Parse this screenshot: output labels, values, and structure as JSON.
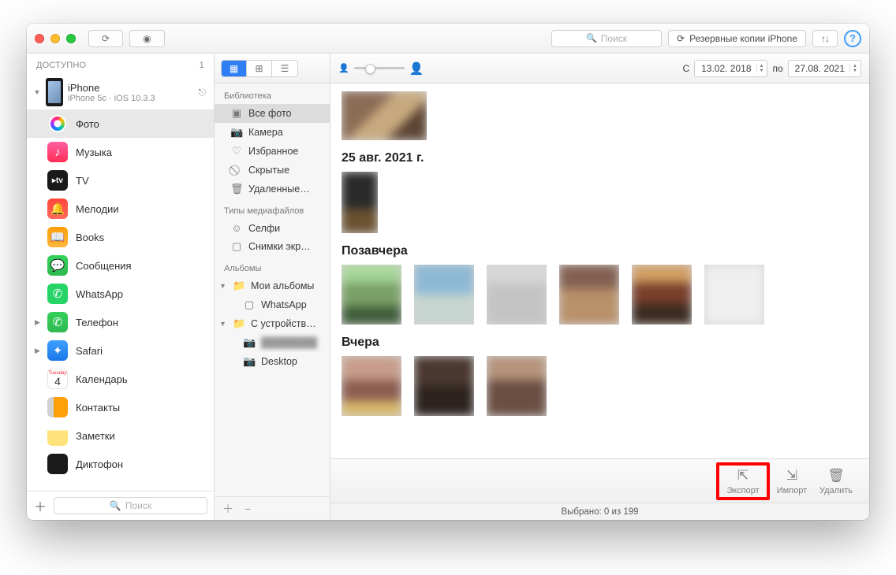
{
  "toolbar": {
    "search_placeholder": "Поиск",
    "backup_label": "Резервные копии iPhone",
    "help_label": "?"
  },
  "sidebar": {
    "section_title": "ДОСТУПНО",
    "device_count": "1",
    "device_name": "iPhone",
    "device_sub": "iPhone 5c · iOS 10.3.3",
    "items": [
      {
        "label": "Фото"
      },
      {
        "label": "Музыка"
      },
      {
        "label": "TV"
      },
      {
        "label": "Мелодии"
      },
      {
        "label": "Books"
      },
      {
        "label": "Сообщения"
      },
      {
        "label": "WhatsApp"
      },
      {
        "label": "Телефон"
      },
      {
        "label": "Safari"
      },
      {
        "label": "Календарь"
      },
      {
        "label": "Контакты"
      },
      {
        "label": "Заметки"
      },
      {
        "label": "Диктофон"
      }
    ],
    "bottom_search": "Поиск"
  },
  "library": {
    "section_lib": "Библиотека",
    "all_photos": "Все фото",
    "camera": "Камера",
    "favorites": "Избранное",
    "hidden": "Скрытые",
    "deleted": "Удаленные…",
    "section_types": "Типы медиафайлов",
    "selfies": "Селфи",
    "screenshots": "Снимки экр…",
    "section_albums": "Альбомы",
    "my_albums": "Мои альбомы",
    "whatsapp": "WhatsApp",
    "from_device": "С устройств…",
    "desktop": "Desktop"
  },
  "dates": {
    "from_label": "С",
    "from_value": "13.02. 2018",
    "to_label": "по",
    "to_value": "27.08. 2021"
  },
  "sections": {
    "s1": "25 авг. 2021 г.",
    "s2": "Позавчера",
    "s3": "Вчера"
  },
  "actions": {
    "export": "Экспорт",
    "import": "Импорт",
    "delete": "Удалить"
  },
  "status": "Выбрано: 0 из 199"
}
